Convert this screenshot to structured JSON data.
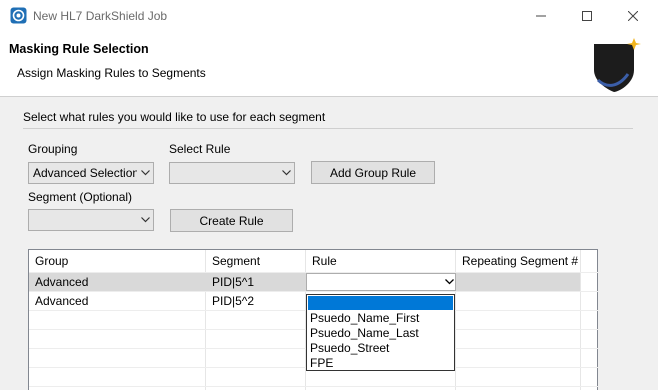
{
  "window": {
    "title": "New HL7 DarkShield Job"
  },
  "banner": {
    "title": "Masking Rule Selection",
    "description": "Assign Masking Rules to Segments"
  },
  "page": {
    "instruction": "Select what rules you would like to use for each segment",
    "grouping_label": "Grouping",
    "grouping_value": "Advanced Selection",
    "select_rule_label": "Select Rule",
    "select_rule_value": "",
    "add_group_rule_label": "Add Group Rule",
    "segment_label": "Segment (Optional)",
    "segment_value": "",
    "create_rule_label": "Create Rule"
  },
  "table": {
    "columns": [
      "Group",
      "Segment",
      "Rule",
      "Repeating Segment #"
    ],
    "rows": [
      {
        "group": "Advanced",
        "segment": "PID|5^1",
        "rule": "",
        "repeating": ""
      },
      {
        "group": "Advanced",
        "segment": "PID|5^2",
        "rule": "",
        "repeating": ""
      }
    ]
  },
  "rule_dropdown": {
    "options": [
      "",
      "Psuedo_Name_First",
      "Psuedo_Name_Last",
      "Psuedo_Street",
      "FPE"
    ],
    "highlighted_index": 0
  },
  "icons": {
    "app": "darkshield-app-icon",
    "minimize": "minimize-icon",
    "maximize": "maximize-icon",
    "close": "close-icon",
    "banner": "shield-logo-icon",
    "dropdown": "chevron-down-icon"
  },
  "colors": {
    "selection": "#0078d7",
    "panel_bg": "#f0f0f0",
    "row_selected": "#d9d9d9"
  }
}
